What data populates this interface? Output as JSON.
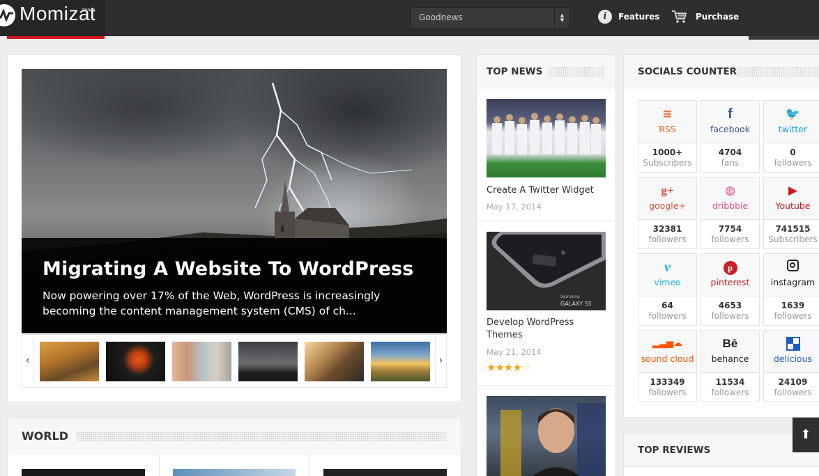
{
  "header": {
    "logo_text": "Momizat",
    "logo_sub": "team",
    "select_value": "Goodnews",
    "nav": [
      {
        "label": "Features",
        "icon": "info-icon"
      },
      {
        "label": "Purchase",
        "icon": "cart-icon"
      }
    ]
  },
  "featured": {
    "title": "Migrating A Website To WordPress",
    "excerpt": "Now powering over 17% of the Web, WordPress is increasingly becoming the content management system (CMS) of ch...",
    "prev_arrow": "‹",
    "next_arrow": "›",
    "thumbnails": [
      "autumn-walk",
      "soccer-player",
      "two-men",
      "storm-church",
      "interior-room",
      "sunset-field"
    ]
  },
  "world": {
    "title": "WORLD"
  },
  "top_news": {
    "title": "TOP NEWS",
    "items": [
      {
        "title": "Create A Twitter Widget",
        "date": "May 17, 2014"
      },
      {
        "title": "Develop WordPress Themes",
        "date": "May 21, 2014",
        "rating": 4
      }
    ],
    "phone_brand": "Samsung",
    "phone_model": "GALAXY S5"
  },
  "socials": {
    "title": "SOCIALS COUNTER",
    "items": [
      {
        "name": "RSS",
        "count": "1000+",
        "unit": "Subscribers",
        "color": "#f26522",
        "icon": "rss-icon"
      },
      {
        "name": "facebook",
        "count": "4704",
        "unit": "fans",
        "color": "#3b5998",
        "icon": "facebook-icon"
      },
      {
        "name": "twitter",
        "count": "0",
        "unit": "followers",
        "color": "#1da1f2",
        "icon": "twitter-icon"
      },
      {
        "name": "google+",
        "count": "32381",
        "unit": "followers",
        "color": "#dd4b39",
        "icon": "googleplus-icon"
      },
      {
        "name": "dribbble",
        "count": "7754",
        "unit": "followers",
        "color": "#ea4c89",
        "icon": "dribbble-icon"
      },
      {
        "name": "Youtube",
        "count": "741515",
        "unit": "Subscribers",
        "color": "#cc181e",
        "icon": "youtube-icon"
      },
      {
        "name": "vimeo",
        "count": "64",
        "unit": "followers",
        "color": "#1ab7ea",
        "icon": "vimeo-icon"
      },
      {
        "name": "pinterest",
        "count": "4653",
        "unit": "followers",
        "color": "#cb2027",
        "icon": "pinterest-icon"
      },
      {
        "name": "instagram",
        "count": "1639",
        "unit": "followers",
        "color": "#222222",
        "icon": "instagram-icon"
      },
      {
        "name": "sound cloud",
        "count": "133349",
        "unit": "followers",
        "color": "#ff5500",
        "icon": "soundcloud-icon"
      },
      {
        "name": "behance",
        "count": "11534",
        "unit": "followers",
        "color": "#222222",
        "icon": "behance-icon"
      },
      {
        "name": "delicious",
        "count": "24109",
        "unit": "followers",
        "color": "#205cc0",
        "icon": "delicious-icon"
      }
    ]
  },
  "reviews": {
    "title": "TOP REVIEWS"
  },
  "back_to_top": "⬆"
}
